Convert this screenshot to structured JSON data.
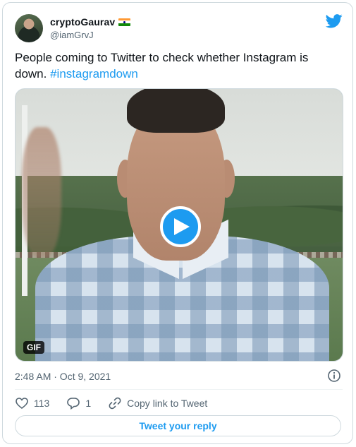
{
  "author": {
    "display_name": "cryptoGaurav",
    "handle": "@iamGrvJ",
    "flag_icon": "india-flag-icon"
  },
  "tweet": {
    "text_before": "People coming to Twitter to check whether Instagram is down. ",
    "hashtag": "#instagramdown"
  },
  "media": {
    "badge": "GIF",
    "play_icon": "play-icon"
  },
  "meta": {
    "timestamp": "2:48 AM · Oct 9, 2021"
  },
  "actions": {
    "likes": "113",
    "replies": "1",
    "copy_link_label": "Copy link to Tweet"
  },
  "reply_button": {
    "label": "Tweet your reply"
  },
  "colors": {
    "accent": "#1d9bf0",
    "secondary_text": "#536471",
    "border": "#cfd9de"
  }
}
